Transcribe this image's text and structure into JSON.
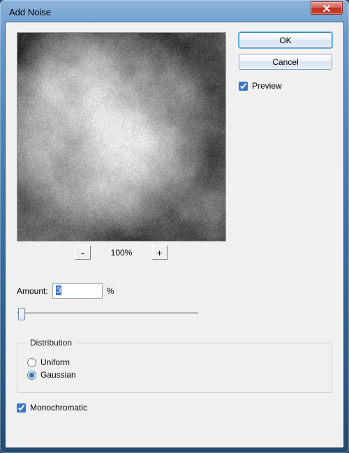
{
  "window": {
    "title": "Add Noise"
  },
  "buttons": {
    "ok": "OK",
    "cancel": "Cancel"
  },
  "preview_checkbox": {
    "label": "Preview",
    "checked": true
  },
  "zoom": {
    "minus": "-",
    "plus": "+",
    "level": "100%"
  },
  "amount": {
    "label": "Amount:",
    "value": "3",
    "unit": "%",
    "slider_min": 0,
    "slider_max": 400,
    "slider_value": 3
  },
  "distribution": {
    "legend": "Distribution",
    "options": {
      "uniform": "Uniform",
      "gaussian": "Gaussian"
    },
    "selected": "gaussian"
  },
  "monochromatic": {
    "label": "Monochromatic",
    "checked": true
  }
}
